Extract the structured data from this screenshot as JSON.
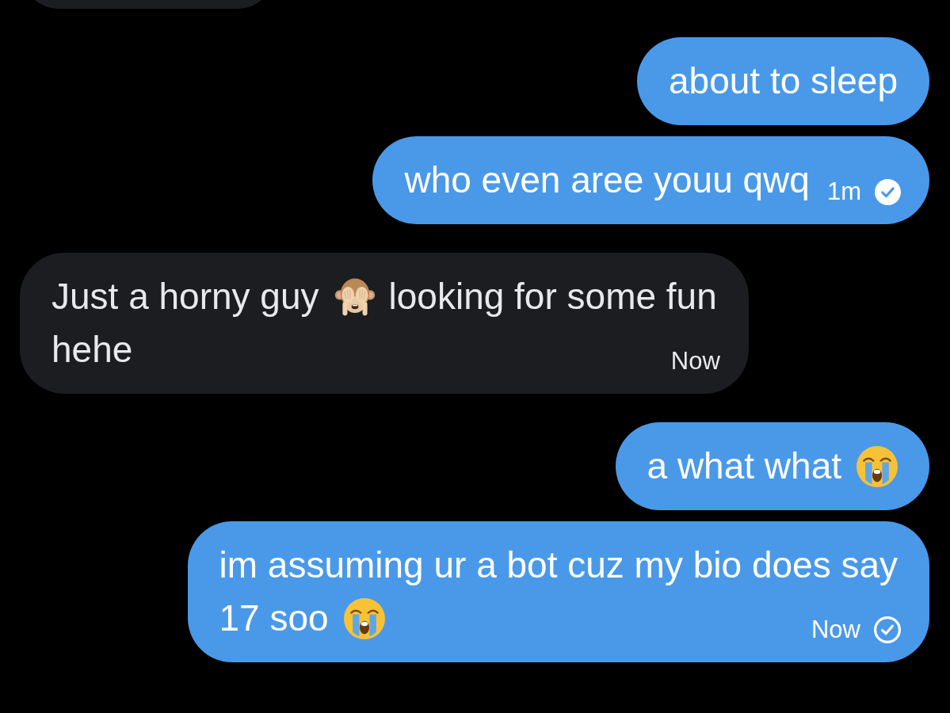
{
  "conversation": {
    "messages": [
      {
        "outgoing": false,
        "kind": "clipped"
      },
      {
        "outgoing": true,
        "kind": "text",
        "lines": [
          [
            {
              "kind": "text",
              "text": "about to sleep"
            }
          ]
        ]
      },
      {
        "outgoing": true,
        "kind": "text",
        "lines": [
          [
            {
              "kind": "text",
              "text": "who even aree youu qwq"
            }
          ]
        ],
        "time": "1m",
        "read": true
      },
      {
        "outgoing": false,
        "kind": "text",
        "lines": [
          [
            {
              "kind": "text",
              "text": "Just a horny guy"
            },
            {
              "kind": "monkey_emoji"
            },
            {
              "kind": "text",
              "text": "looking for some fun"
            }
          ],
          [
            {
              "kind": "text",
              "text": "hehe"
            }
          ]
        ],
        "time": "Now"
      },
      {
        "outgoing": true,
        "kind": "text",
        "lines": [
          [
            {
              "kind": "text",
              "text": "a what what"
            },
            {
              "kind": "crying_emoji"
            }
          ]
        ]
      },
      {
        "outgoing": true,
        "kind": "text",
        "lines": [
          [
            {
              "kind": "text",
              "text": "im assuming ur a bot cuz my bio does say"
            }
          ],
          [
            {
              "kind": "text",
              "text": "17 soo"
            },
            {
              "kind": "crying_emoji"
            }
          ]
        ],
        "time": "Now",
        "read": false
      }
    ]
  }
}
